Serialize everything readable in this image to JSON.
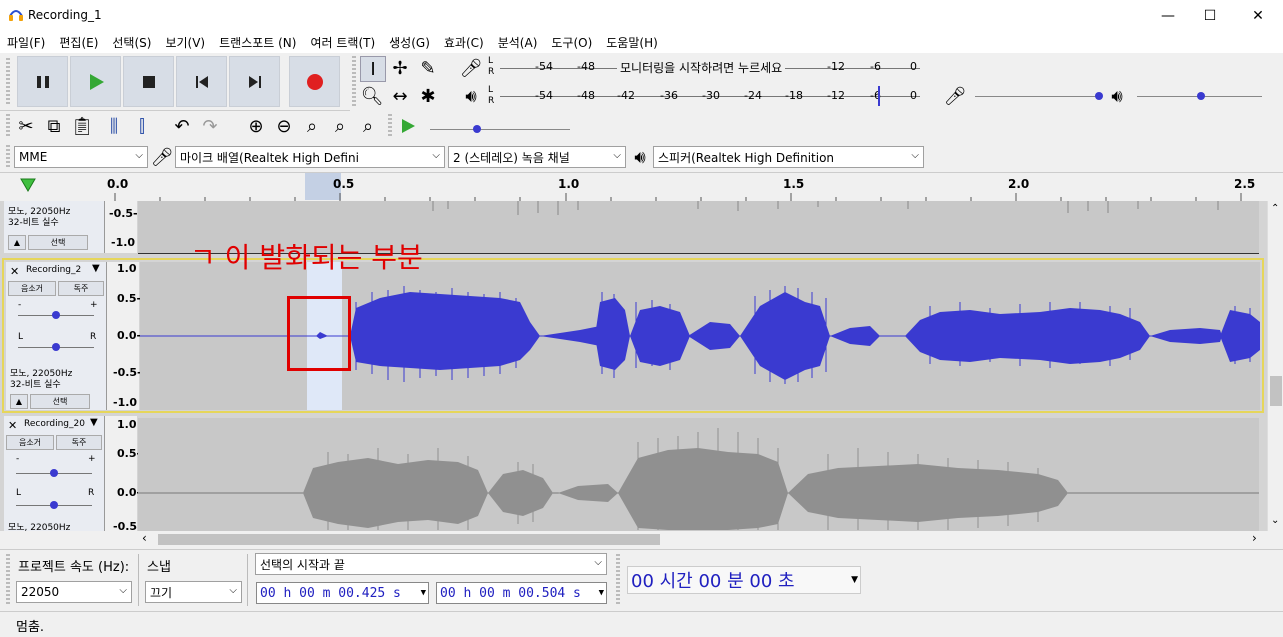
{
  "window": {
    "title": "Recording_1",
    "min": "—",
    "max": "☐",
    "close": "✕"
  },
  "menu": [
    "파일(F)",
    "편집(E)",
    "선택(S)",
    "보기(V)",
    "트랜스포트 (N)",
    "여러 트랙(T)",
    "생성(G)",
    "효과(C)",
    "분석(A)",
    "도구(O)",
    "도움말(H)"
  ],
  "meter": {
    "record_prompt": "모니터링을 시작하려면 누르세요",
    "record_ticks_left": [
      "-54",
      "-48"
    ],
    "record_ticks_right": [
      "-12",
      "-6",
      "0"
    ],
    "play_ticks": [
      "-54",
      "-48",
      "-42",
      "-36",
      "-30",
      "-24",
      "-18",
      "-12",
      "-6",
      "0"
    ],
    "lr_l": "L",
    "lr_r": "R"
  },
  "device": {
    "host": "MME",
    "mic": "마이크 배열(Realtek High Defini",
    "channels": "2 (스테레오) 녹음 채널",
    "speaker": "스피커(Realtek High Definition"
  },
  "ruler": {
    "labels": [
      "0.0",
      "0.5",
      "1.0",
      "1.5",
      "2.0",
      "2.5"
    ]
  },
  "annotation": "ㄱ  이 발화되는 부분",
  "track_top": {
    "info1": "모노, 22050Hz",
    "info2": "32-비트 실수",
    "select": "선택",
    "scale": [
      "-0.5-",
      "-1.0"
    ]
  },
  "track_sel": {
    "name": "Recording_2",
    "mute": "음소거",
    "solo": "독주",
    "gain_minus": "-",
    "gain_plus": "+",
    "pan_l": "L",
    "pan_r": "R",
    "info1": "모노, 22050Hz",
    "info2": "32-비트 실수",
    "select": "선택",
    "scale": [
      "1.0",
      "0.5-",
      "0.0-",
      "-0.5-",
      "-1.0"
    ]
  },
  "track_bot": {
    "name": "Recording_20",
    "mute": "음소거",
    "solo": "독주",
    "gain_minus": "-",
    "gain_plus": "+",
    "pan_l": "L",
    "pan_r": "R",
    "info1": "모노, 22050Hz",
    "scale": [
      "1.0",
      "0.5-",
      "0.0-",
      "-0.5"
    ]
  },
  "bottom": {
    "rate_label": "프로젝트 속도 (Hz):",
    "rate_value": "22050",
    "snap_label": "스냅",
    "snap_value": "끄기",
    "sel_label": "선택의 시작과 끝",
    "sel_start": "00 h 00 m 00.425 s",
    "sel_end": "00 h 00 m 00.504 s",
    "time": "00 시간 00 분 00 초",
    "status": "멈춤."
  },
  "colors": {
    "accent": "#3a3ad0",
    "annotation": "#e00000",
    "selection": "#dfe8f8"
  }
}
